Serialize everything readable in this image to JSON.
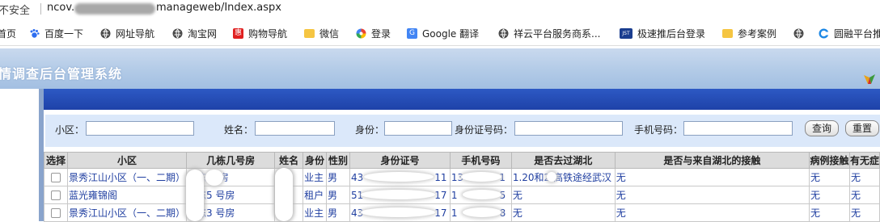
{
  "browser": {
    "security_label": "不安全",
    "url_prefix": "ncov.",
    "url_suffix": "manageweb/Index.aspx"
  },
  "bookmarks": [
    {
      "label": "首页",
      "icon": "home-icon",
      "color": "#ffffff"
    },
    {
      "label": "百度一下",
      "icon": "baidu-paw-icon",
      "color": "#2e6ef0"
    },
    {
      "label": "网址导航",
      "icon": "globe-icon",
      "color": "#555555"
    },
    {
      "label": "淘宝网",
      "icon": "globe-icon",
      "color": "#555555"
    },
    {
      "label": "购物导航",
      "icon": "hui-icon",
      "color": "#e02020"
    },
    {
      "label": "微信",
      "icon": "folder-icon",
      "color": "#f5c542"
    },
    {
      "label": "登录",
      "icon": "pinwheel-icon",
      "color": "#34a853"
    },
    {
      "label": "Google 翻译",
      "icon": "translate-icon",
      "color": "#4285f4"
    },
    {
      "label": "祥云平台服务商系...",
      "icon": "globe-icon",
      "color": "#555555"
    },
    {
      "label": "极速推后台登录",
      "icon": "jst-icon",
      "color": "#1a3d8f"
    },
    {
      "label": "参考案例",
      "icon": "folder-icon",
      "color": "#f5c542"
    },
    {
      "label": "",
      "icon": "globe-icon",
      "color": "#555555"
    },
    {
      "label": "圆融平台推",
      "icon": "ring-icon",
      "color": "#1e88e5"
    }
  ],
  "app": {
    "title": "情调查后台管理系统"
  },
  "search": {
    "community_label": "小区：",
    "name_label": "姓名：",
    "identity_label": "身份：",
    "id_number_label": "身份证号码：",
    "phone_label": "手机号码：",
    "query_button": "查询",
    "reset_button": "重置"
  },
  "table": {
    "headers": [
      "选择",
      "小区",
      "几栋几号房",
      "姓名",
      "身份",
      "性别",
      "身份证号",
      "手机号码",
      "是否去过湖北",
      "是否与来自湖北的接触",
      "病例接触",
      "有无症"
    ],
    "rows": [
      {
        "community": "景秀江山小区（一、二期）",
        "room": "栋   号房",
        "name": "",
        "identity": "业主",
        "gender": "男",
        "id_number_start": "43",
        "id_number_end": "11",
        "phone_start": "13",
        "phone_end": "1",
        "hubei": "1.20和2   高铁途经武汉",
        "contact_hubei": "无",
        "case_contact": "无",
        "symptoms": "无"
      },
      {
        "community": "蓝光雍锦阁",
        "room": "栋5   号房",
        "name": "",
        "identity": "租户",
        "gender": "男",
        "id_number_start": "51",
        "id_number_end": "17",
        "phone_start": "1",
        "phone_end": "5",
        "hubei": "无",
        "contact_hubei": "无",
        "case_contact": "无",
        "symptoms": "无"
      },
      {
        "community": "景秀江山小区（一、二期）",
        "room": "栋3   号房",
        "name": "",
        "identity": "业主",
        "gender": "男",
        "id_number_start": "43",
        "id_number_end": "17",
        "phone_start": "1",
        "phone_end": "8",
        "hubei": "无",
        "contact_hubei": "无",
        "case_contact": "无",
        "symptoms": "无"
      }
    ]
  }
}
